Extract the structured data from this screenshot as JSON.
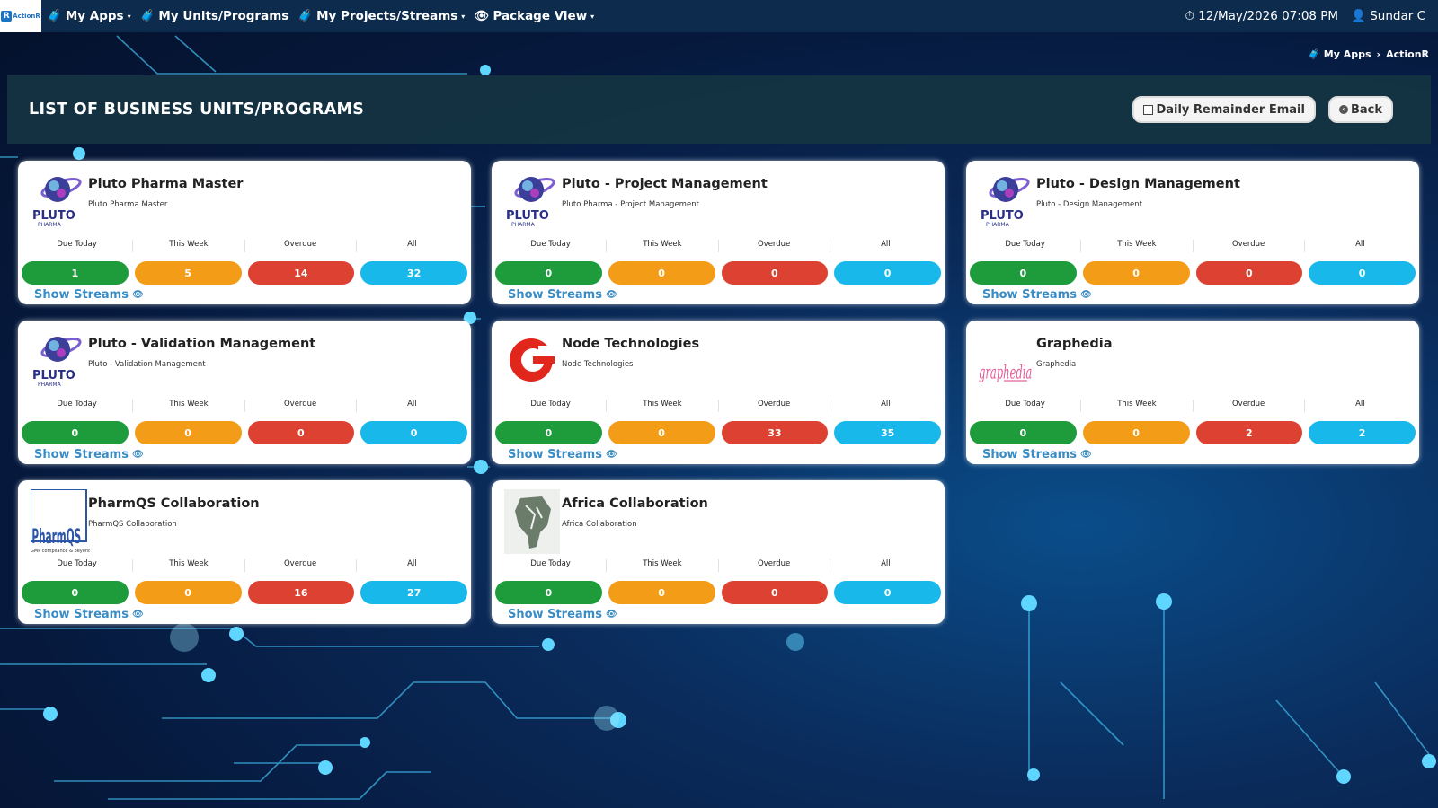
{
  "nav": {
    "logo_text": "ActionR",
    "logo_letter": "R",
    "items": [
      {
        "label": "My Apps",
        "icon": "briefcase-icon",
        "caret": "▾"
      },
      {
        "label": "My Units/Programs",
        "icon": "briefcase-icon",
        "caret": ""
      },
      {
        "label": "My Projects/Streams",
        "icon": "briefcase-icon",
        "caret": "▾"
      },
      {
        "label": "Package View",
        "icon": "eye-icon",
        "caret": "▾"
      }
    ],
    "datetime": "12/May/2026 07:08 PM",
    "user": "Sundar C"
  },
  "breadcrumb": {
    "home": "My Apps",
    "separator": "›",
    "current": "ActionR"
  },
  "header": {
    "title": "LIST OF BUSINESS UNITS/PROGRAMS",
    "reminder_label": "Daily Remainder Email",
    "back_label": "Back"
  },
  "stat_labels": [
    "Due Today",
    "This Week",
    "Overdue",
    "All"
  ],
  "show_streams_label": "Show Streams",
  "cards": [
    {
      "name": "Pluto Pharma Master",
      "sub": "Pluto Pharma Master",
      "logo": "pluto",
      "counts": [
        "1",
        "5",
        "14",
        "32"
      ]
    },
    {
      "name": "Pluto - Project Management",
      "sub": "Pluto Pharma - Project Management",
      "logo": "pluto",
      "counts": [
        "0",
        "0",
        "0",
        "0"
      ]
    },
    {
      "name": "Pluto - Design Management",
      "sub": "Pluto - Design Management",
      "logo": "pluto",
      "counts": [
        "0",
        "0",
        "0",
        "0"
      ]
    },
    {
      "name": "Pluto - Validation Management",
      "sub": "Pluto - Validation Management",
      "logo": "pluto",
      "counts": [
        "0",
        "0",
        "0",
        "0"
      ]
    },
    {
      "name": "Node Technologies",
      "sub": "Node Technologies",
      "logo": "node",
      "counts": [
        "0",
        "0",
        "33",
        "35"
      ]
    },
    {
      "name": "Graphedia",
      "sub": "Graphedia",
      "logo": "graphedia",
      "counts": [
        "0",
        "0",
        "2",
        "2"
      ]
    },
    {
      "name": "PharmQS Collaboration",
      "sub": "PharmQS Collaboration",
      "logo": "pharmqs",
      "counts": [
        "0",
        "0",
        "16",
        "27"
      ]
    },
    {
      "name": "Africa Collaboration",
      "sub": "Africa Collaboration",
      "logo": "africa",
      "counts": [
        "0",
        "0",
        "0",
        "0"
      ]
    }
  ],
  "logo_texts": {
    "pluto_word": "PLUTO",
    "pluto_sub": "PHARMA",
    "graphedia_word": "graphedia",
    "pharmqs_word": "PharmQS",
    "pharmqs_tag": "GMP compliance & beyond"
  },
  "colors": {
    "green": "#1e9c3c",
    "orange": "#f39c17",
    "red": "#dd4131",
    "blue": "#19b8ea",
    "link": "#3a8cc4"
  }
}
